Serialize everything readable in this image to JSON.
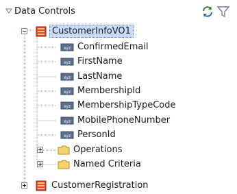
{
  "panel": {
    "title": "Data Controls",
    "toolbar": {
      "refresh_icon": "refresh-icon",
      "filter_icon": "filter-icon"
    }
  },
  "tree": {
    "root": {
      "label": "CustomerInfoVO1",
      "icon": "view-object-icon",
      "expanded": true,
      "selected": true,
      "attributes": [
        {
          "label": "ConfirmedEmail",
          "icon": "attribute-icon"
        },
        {
          "label": "FirstName",
          "icon": "attribute-icon"
        },
        {
          "label": "LastName",
          "icon": "attribute-icon"
        },
        {
          "label": "MembershipId",
          "icon": "attribute-icon"
        },
        {
          "label": "MembershipTypeCode",
          "icon": "attribute-icon"
        },
        {
          "label": "MobilePhoneNumber",
          "icon": "attribute-icon"
        },
        {
          "label": "PersonId",
          "icon": "attribute-icon"
        }
      ],
      "folders": [
        {
          "label": "Operations",
          "icon": "folder-icon",
          "expanded": false
        },
        {
          "label": "Named Criteria",
          "icon": "folder-icon",
          "expanded": false
        }
      ]
    },
    "sibling": {
      "label": "CustomerRegistration",
      "icon": "view-object-icon",
      "expanded": false
    }
  },
  "colors": {
    "selection_bg": "#c8dcf8",
    "folder": "#f3d36b",
    "view_object": "#e2483b"
  }
}
